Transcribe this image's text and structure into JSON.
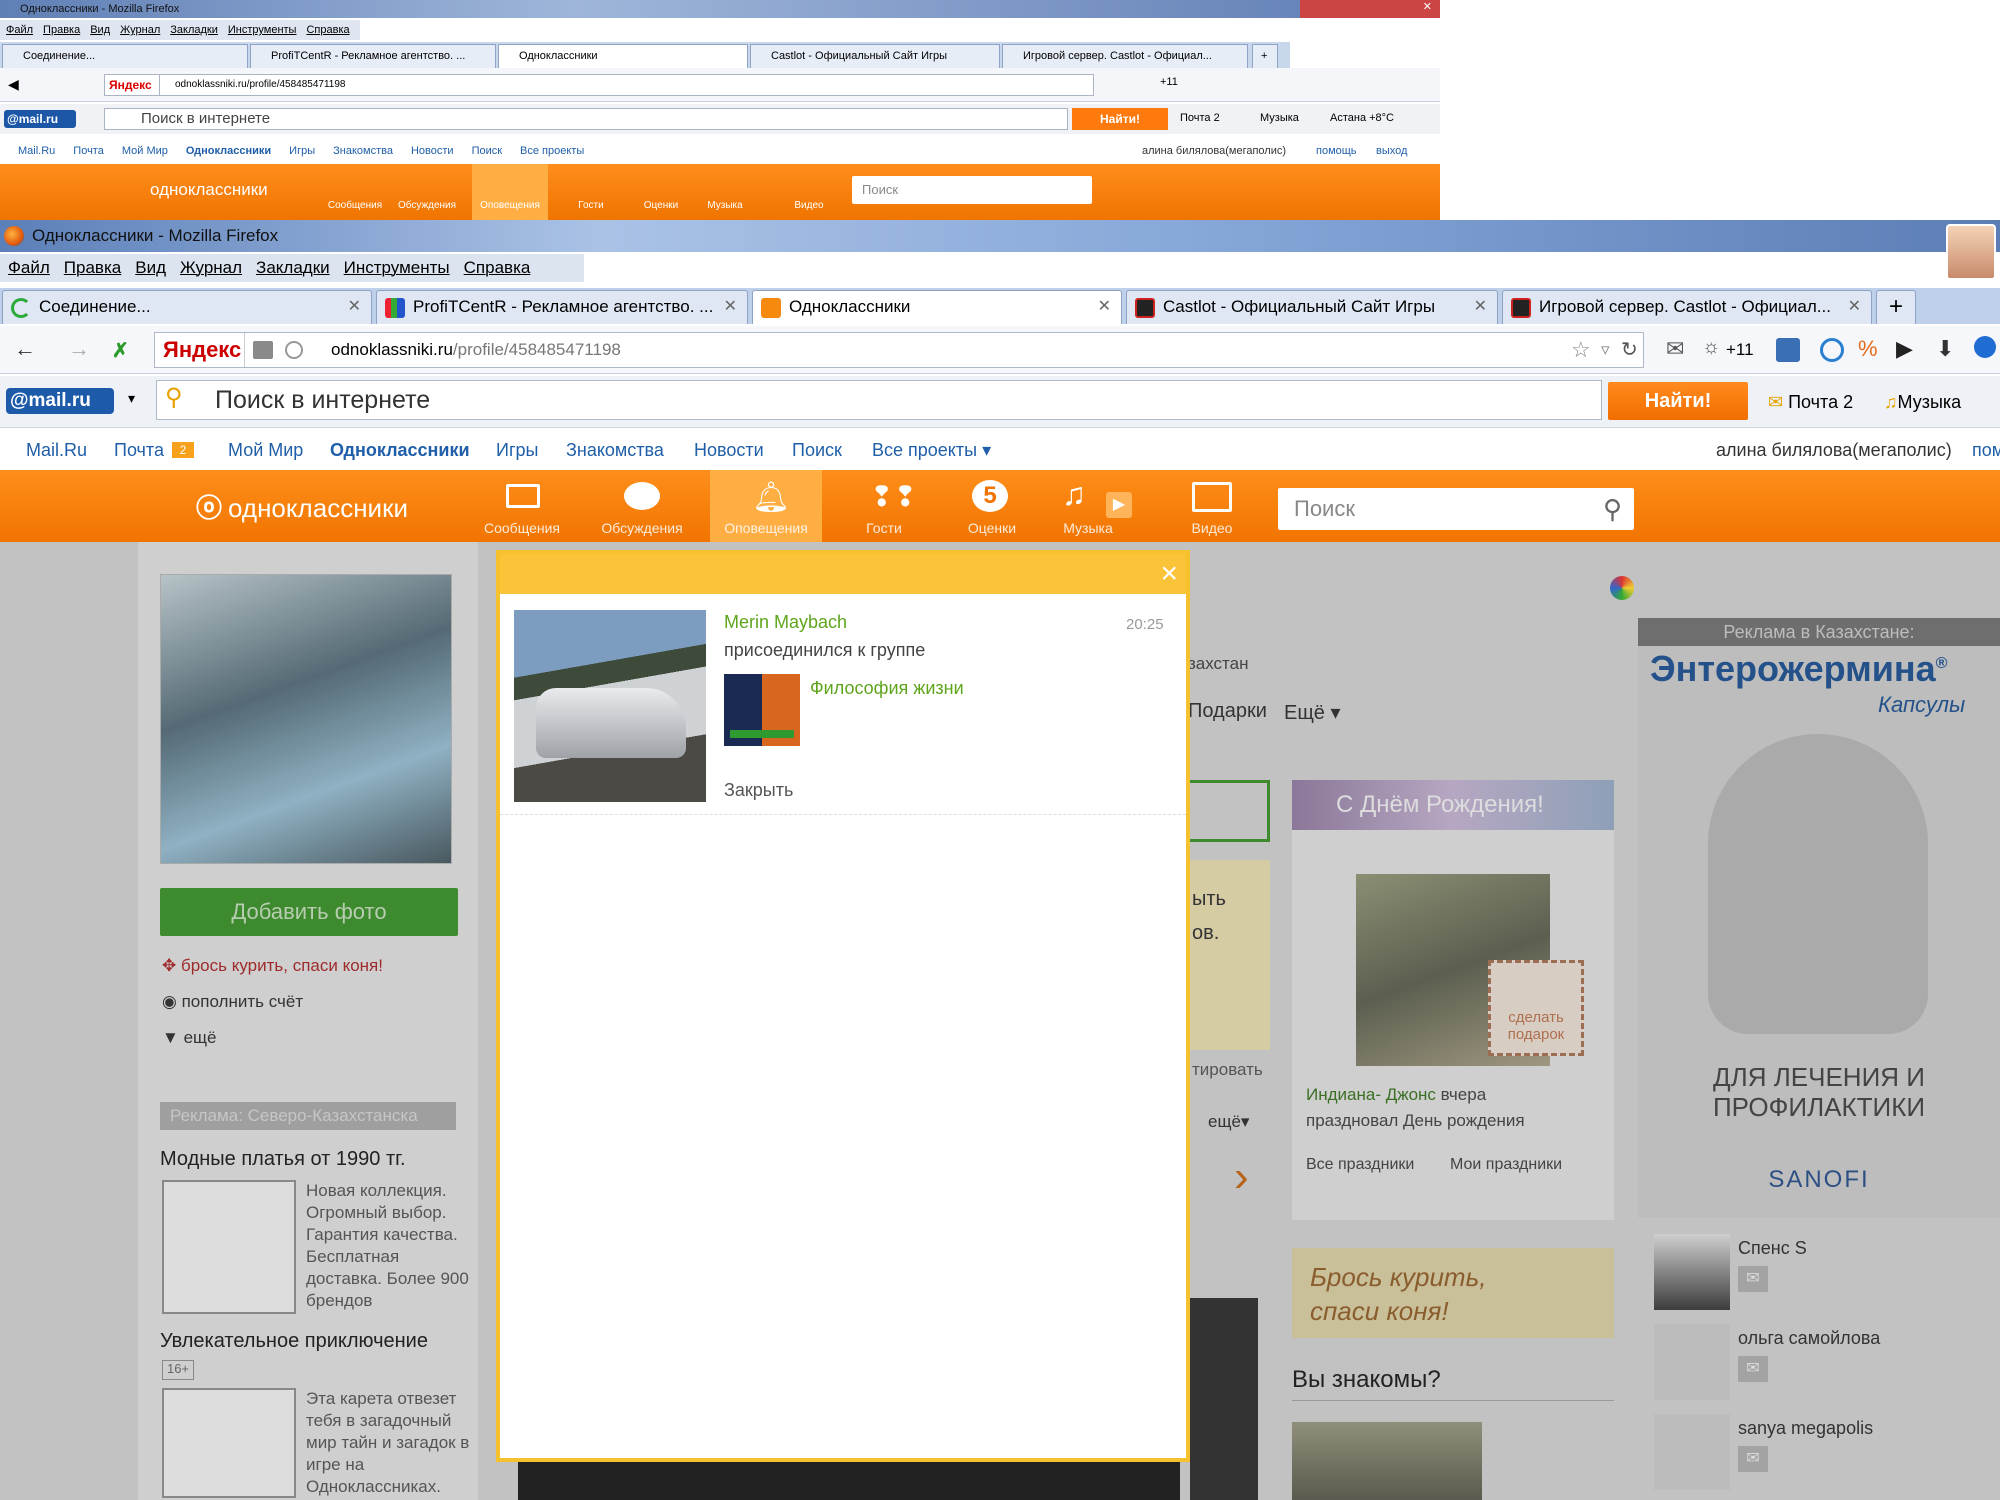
{
  "small": {
    "title": "Одноклассники - Mozilla Firefox",
    "menu": [
      "Файл",
      "Правка",
      "Вид",
      "Журнал",
      "Закладки",
      "Инструменты",
      "Справка"
    ],
    "tabs": [
      "Соединение...",
      "ProfiTCentR - Рекламное агентство. ...",
      "Одноклассники",
      "Castlot - Официальный Сайт Игры",
      "Игровой сервер. Castlot - Официал..."
    ],
    "yandex": "Яндекс",
    "url": "odnoklassniki.ru/profile/458485471198",
    "extra": "+11",
    "mailru": "@mail.ru",
    "search_placeholder": "Поиск в интернете",
    "find": "Найти!",
    "mail": "Почта 2",
    "music": "Музыка",
    "weather": "Астана +8°C",
    "projects": [
      "Mail.Ru",
      "Почта",
      "Мой Мир",
      "Одноклассники",
      "Игры",
      "Знакомства",
      "Новости",
      "Поиск",
      "Все проекты"
    ],
    "mail_count": "2",
    "user": "алина билялова(мегаполис)",
    "help": "помощь",
    "logout": "выход",
    "ok_logo": "одноклассники",
    "nav": [
      "Сообщения",
      "Обсуждения",
      "Оповещения",
      "Гости",
      "Оценки",
      "Музыка",
      "Видео"
    ],
    "ok_search": "Поиск"
  },
  "window": {
    "title": "Одноклассники - Mozilla Firefox",
    "menu": [
      "Файл",
      "Правка",
      "Вид",
      "Журнал",
      "Закладки",
      "Инструменты",
      "Справка"
    ],
    "tabs": [
      "Соединение...",
      "ProfiTCentR - Рекламное агентство. ...",
      "Одноклассники",
      "Castlot - Официальный Сайт Игры",
      "Игровой сервер. Castlot - Официал..."
    ],
    "yandex": "Яндекс",
    "url_host": "odnoklassniki.ru",
    "url_path": "/profile/458485471198",
    "extra": "+11",
    "mailru": "@mail.ru",
    "search_placeholder": "Поиск в интернете",
    "find": "Найти!",
    "mail": "Почта 2",
    "music": "Музыка"
  },
  "projects": {
    "items": [
      "Mail.Ru",
      "Почта",
      "Мой Мир",
      "Одноклассники",
      "Игры",
      "Знакомства",
      "Новости",
      "Поиск",
      "Все проекты"
    ],
    "mail_count": "2",
    "user": "алина билялова(мегаполис)",
    "help": "пом"
  },
  "ok": {
    "logo": "одноклассники",
    "nav": [
      "Сообщения",
      "Обсуждения",
      "Оповещения",
      "Гости",
      "Оценки",
      "Музыка",
      "Видео"
    ],
    "search": "Поиск",
    "ratings_count": "5"
  },
  "profile": {
    "add_photo": "Добавить фото",
    "links": [
      "брось курить, спаси коня!",
      "пополнить счёт",
      "ещё"
    ],
    "ad_header": "Реклама: Северо-Казахстанска",
    "ad1_title": "Модные платья от 1990 тг.",
    "ad1_text": "Новая коллекция. Огромный выбор. Гарантия качества. Бесплатная доставка. Более 900 брендов",
    "ad2_title": "Увлекательное приключение",
    "ad2_age": "16+",
    "ad2_text": "Эта карета отвезет тебя в загадочный мир тайн и загадок в игре на Одноклассниках."
  },
  "middle": {
    "location": "захстан",
    "tabs": "Подарки",
    "more": "Ещё ▾",
    "t1": "ыть",
    "t2": "ов.",
    "t3": "тировать",
    "more2": "ещё▾"
  },
  "birthday": {
    "title": "С Днём Рождения!",
    "gift": "сделать подарок",
    "person": "Индиана- Джонс",
    "text1": " вчера",
    "text2": "праздновал День рождения",
    "links": [
      "Все праздники",
      "Мои праздники"
    ]
  },
  "banner": {
    "text1": "Брось курить,",
    "text2": "спаси коня!"
  },
  "know": {
    "title": "Вы знакомы?"
  },
  "ads": {
    "header": "Реклама в Казахстане:",
    "brand": "Энтерожермина",
    "reg": "®",
    "sub": "Капсулы",
    "slogan1": "ДЛЯ ЛЕЧЕНИЯ И",
    "slogan2": "ПРОФИЛАКТИКИ",
    "maker": "SANOFI"
  },
  "friends": [
    "Спенс S",
    "ольга самойлова",
    "sanya megapolis"
  ],
  "modal": {
    "close": "×",
    "name": "Merin Maybach",
    "time": "20:25",
    "action": "присоединился к группе",
    "group": "Философия жизни",
    "dismiss": "Закрыть"
  },
  "colors": {
    "ok_orange": "#f58a0f",
    "modal_border": "#f5c12c",
    "link_green": "#5ea51c",
    "blue_link": "#1f5ea8"
  }
}
